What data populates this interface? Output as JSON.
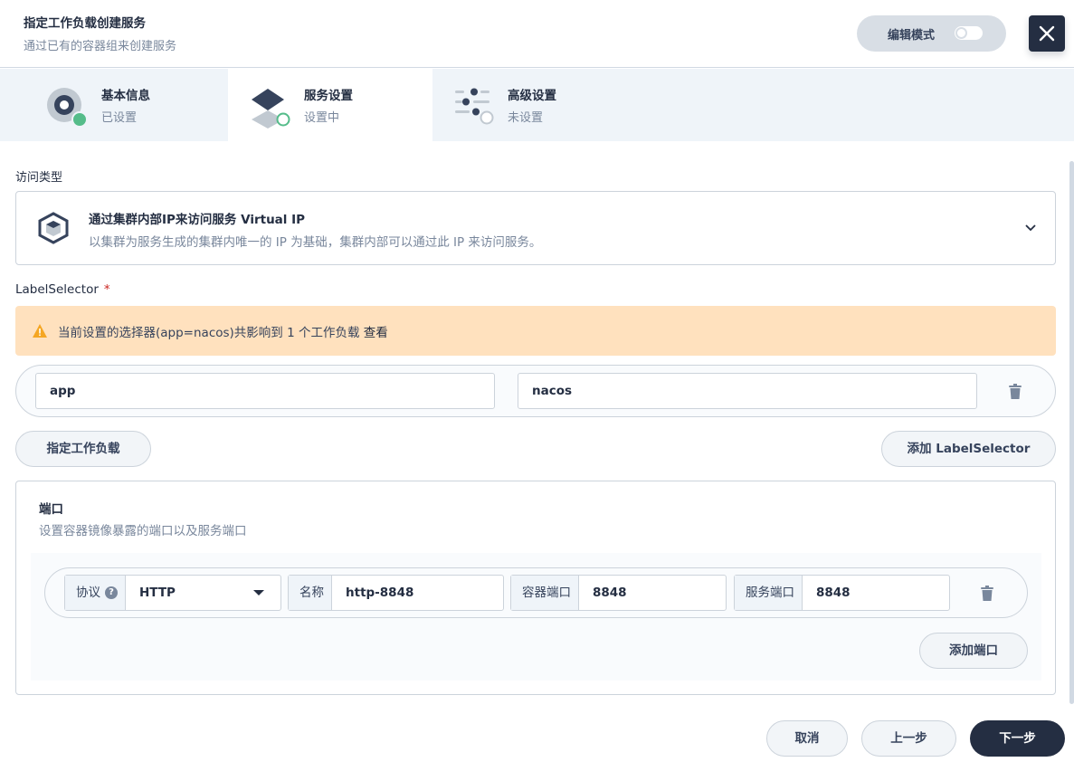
{
  "header": {
    "title": "指定工作负载创建服务",
    "subtitle": "通过已有的容器组来创建服务",
    "edit_mode_label": "编辑模式"
  },
  "steps": [
    {
      "title": "基本信息",
      "status": "已设置",
      "icon": "basic-info-icon"
    },
    {
      "title": "服务设置",
      "status": "设置中",
      "icon": "service-settings-icon"
    },
    {
      "title": "高级设置",
      "status": "未设置",
      "icon": "advanced-settings-icon"
    }
  ],
  "access": {
    "label": "访问类型",
    "title": "通过集群内部IP来访问服务 Virtual IP",
    "description": "以集群为服务生成的集群内唯一的 IP 为基础，集群内部可以通过此 IP 来访问服务。"
  },
  "selector": {
    "label": "LabelSelector",
    "required_mark": "*",
    "warning_text": "当前设置的选择器(app=nacos)共影响到 1 个工作负载",
    "warning_link": "查看",
    "key": "app",
    "value": "nacos",
    "specify_workload_button": "指定工作负载",
    "add_selector_button": "添加 LabelSelector"
  },
  "ports": {
    "title": "端口",
    "description": "设置容器镜像暴露的端口以及服务端口",
    "protocol_label": "协议",
    "protocol_help": "?",
    "protocol_value": "HTTP",
    "name_label": "名称",
    "name_value": "http-8848",
    "container_port_label": "容器端口",
    "container_port_value": "8848",
    "service_port_label": "服务端口",
    "service_port_value": "8848",
    "add_port_button": "添加端口"
  },
  "footer": {
    "cancel": "取消",
    "previous": "上一步",
    "next": "下一步"
  },
  "colors": {
    "primary_dark": "#242e42",
    "success_green": "#55bc8a",
    "warning_bg": "#ffe1be",
    "warning_icon": "#f5a623",
    "border": "#ccd3db"
  }
}
